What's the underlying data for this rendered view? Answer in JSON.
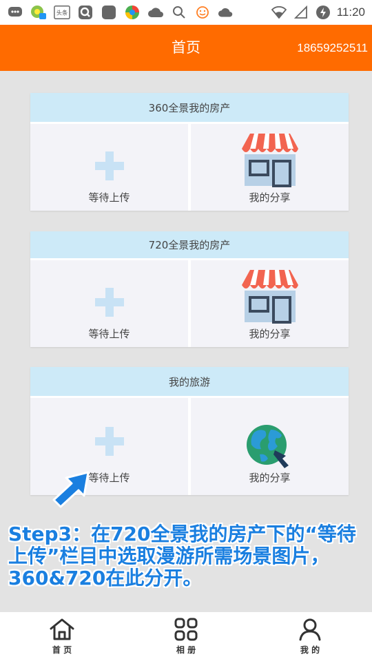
{
  "status": {
    "time": "11:20",
    "toutiao_label": "头条"
  },
  "header": {
    "title": "首页",
    "phone": "18659252511",
    "bg_color": "#ff6b00"
  },
  "sections": [
    {
      "title": "360全景我的房产",
      "left_label": "等待上传",
      "right_label": "我的分享",
      "left_icon": "plus-icon",
      "right_icon": "shop-icon"
    },
    {
      "title": "720全景我的房产",
      "left_label": "等待上传",
      "right_label": "我的分享",
      "left_icon": "plus-icon",
      "right_icon": "shop-icon"
    },
    {
      "title": "我的旅游",
      "left_label": "等待上传",
      "right_label": "我的分享",
      "left_icon": "plus-icon",
      "right_icon": "globe-icon"
    }
  ],
  "annotation": {
    "line1": "Step3：在720全景我的房产下的“等待",
    "line2": "上传”栏目中选取漫游所需场景图片，",
    "line3": "360&720在此分开。",
    "color": "#1a7fe0"
  },
  "tabs": [
    {
      "label": "首 页",
      "icon": "home-icon"
    },
    {
      "label": "相 册",
      "icon": "grid-icon"
    },
    {
      "label": "我 的",
      "icon": "person-icon"
    }
  ]
}
